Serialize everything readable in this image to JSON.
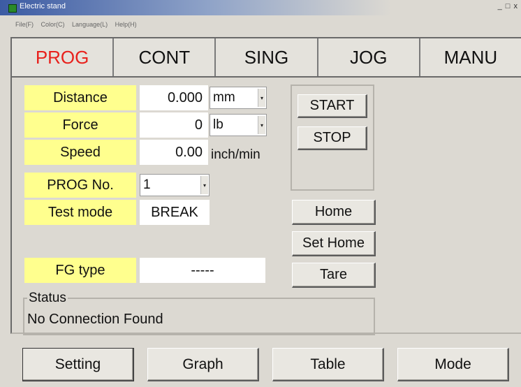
{
  "window": {
    "title": "Electric stand",
    "controls": "_ □ x"
  },
  "menu": {
    "items": [
      "File(F)",
      "Color(C)",
      "Language(L)",
      "Help(H)"
    ]
  },
  "tabs": [
    {
      "label": "PROG",
      "active": true
    },
    {
      "label": "CONT",
      "active": false
    },
    {
      "label": "SING",
      "active": false
    },
    {
      "label": "JOG",
      "active": false
    },
    {
      "label": "MANU",
      "active": false
    }
  ],
  "fields": {
    "distance": {
      "label": "Distance",
      "value": "0.000",
      "unit": "mm"
    },
    "force": {
      "label": "Force",
      "value": "0",
      "unit": "lb"
    },
    "speed": {
      "label": "Speed",
      "value": "0.00",
      "unit": "inch/min"
    },
    "prog_no": {
      "label": "PROG No.",
      "value": "1"
    },
    "test_mode": {
      "label": "Test mode",
      "value": "BREAK"
    },
    "fg_type": {
      "label": "FG type",
      "value": "-----"
    }
  },
  "buttons": {
    "start": "START",
    "stop": "STOP",
    "home": "Home",
    "set_home": "Set Home",
    "tare": "Tare"
  },
  "status": {
    "label": "Status",
    "message": "No Connection Found"
  },
  "bottom": {
    "setting": "Setting",
    "graph": "Graph",
    "table": "Table",
    "mode": "Mode"
  },
  "colors": {
    "label_bg": "#ffff8e",
    "active_tab": "#e8211c",
    "window_bg": "#dcd9d2"
  }
}
